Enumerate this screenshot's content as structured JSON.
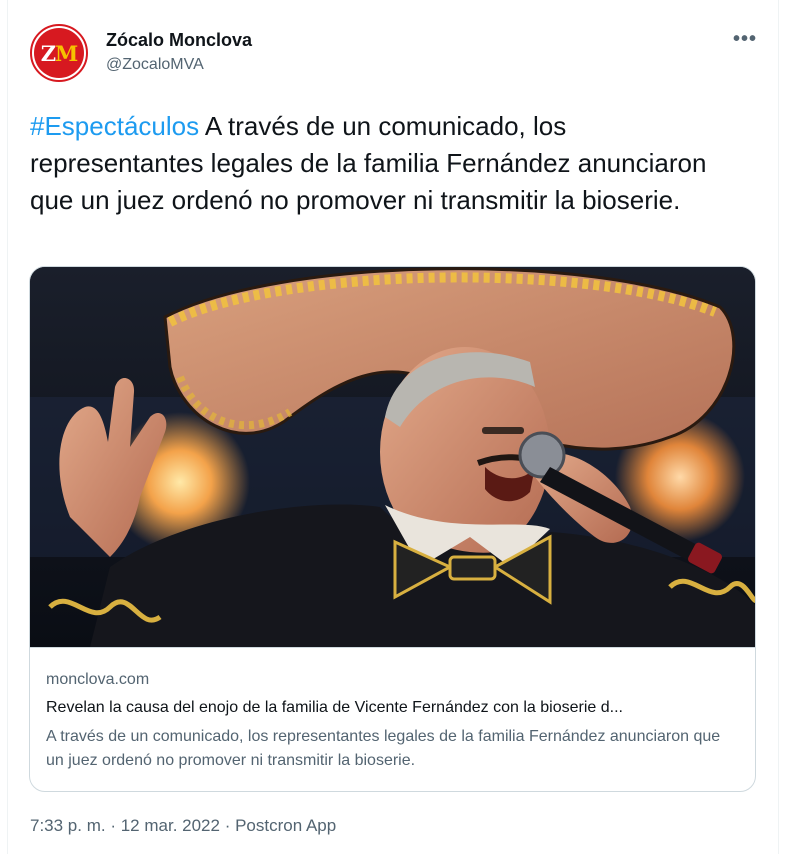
{
  "author": {
    "avatar_text": "ZM",
    "name": "Zócalo Monclova",
    "handle": "@ZocaloMVA"
  },
  "more_icon": "more-horizontal-icon",
  "tweet": {
    "hashtag": "#Espectáculos",
    "text": " A través de un comunicado, los representantes legales de la familia Fernández anunciaron que un juez ordenó no promover ni transmitir la bioserie."
  },
  "card": {
    "image_icon": "singer-photo",
    "image_alt": "Singer with sombrero",
    "domain": "monclova.com",
    "title": "Revelan la causa del enojo de la familia de Vicente Fernández con la bioserie d...",
    "description": "A través de un comunicado, los representantes legales de la familia Fernández anunciaron que un juez ordenó no promover ni transmitir la bioserie."
  },
  "meta": {
    "time": "7:33 p. m.",
    "separator": " · ",
    "date": "12 mar. 2022",
    "source": "Postcron App"
  },
  "colors": {
    "accent": "#1d9bf0",
    "secondary_text": "#536471",
    "brand_red": "#d71920",
    "brand_yellow": "#f6c200"
  }
}
